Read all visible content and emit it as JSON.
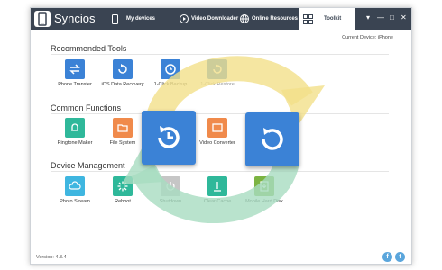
{
  "app": {
    "name": "Syncios",
    "version": "Version: 4.3.4"
  },
  "nav": {
    "my_devices": "My devices",
    "video_downloader": "Video Downloader",
    "online_resources": "Online Resources",
    "toolkit": "Toolkit"
  },
  "window_controls": {
    "menu": "▾",
    "minimize": "—",
    "maximize": "□",
    "close": "✕"
  },
  "current_device": "Current Device: iPhone",
  "sections": {
    "recommended": "Recommended Tools",
    "common": "Common Functions",
    "device": "Device Management"
  },
  "tools": {
    "phone_transfer": "Phone Transfer",
    "ios_data_recovery": "iOS Data Recovery",
    "one_click_backup": "1-Click Backup",
    "one_click_restore": "1-Click Restore",
    "ringtone_maker": "Ringtone Maker",
    "file_system": "File System",
    "video_converter": "Video Converter",
    "photo_stream": "Photo Stream",
    "reboot": "Reboot",
    "shutdown": "Shutdown",
    "clear_cache": "Clear Cache",
    "mobile_hard_disk": "Mobile Hard Disk"
  },
  "social": {
    "facebook": "f",
    "twitter": "t"
  },
  "colors": {
    "topbar": "#3a4452",
    "blue_tile": "#3b82d6",
    "cyan_tile": "#3fb6e0",
    "teal_tile": "#2fb89a",
    "orange_tile": "#f08a4b",
    "green_tile": "#4caf50",
    "yellow_arrow": "#f3e08a",
    "green_arrow": "#a8dcc0"
  }
}
